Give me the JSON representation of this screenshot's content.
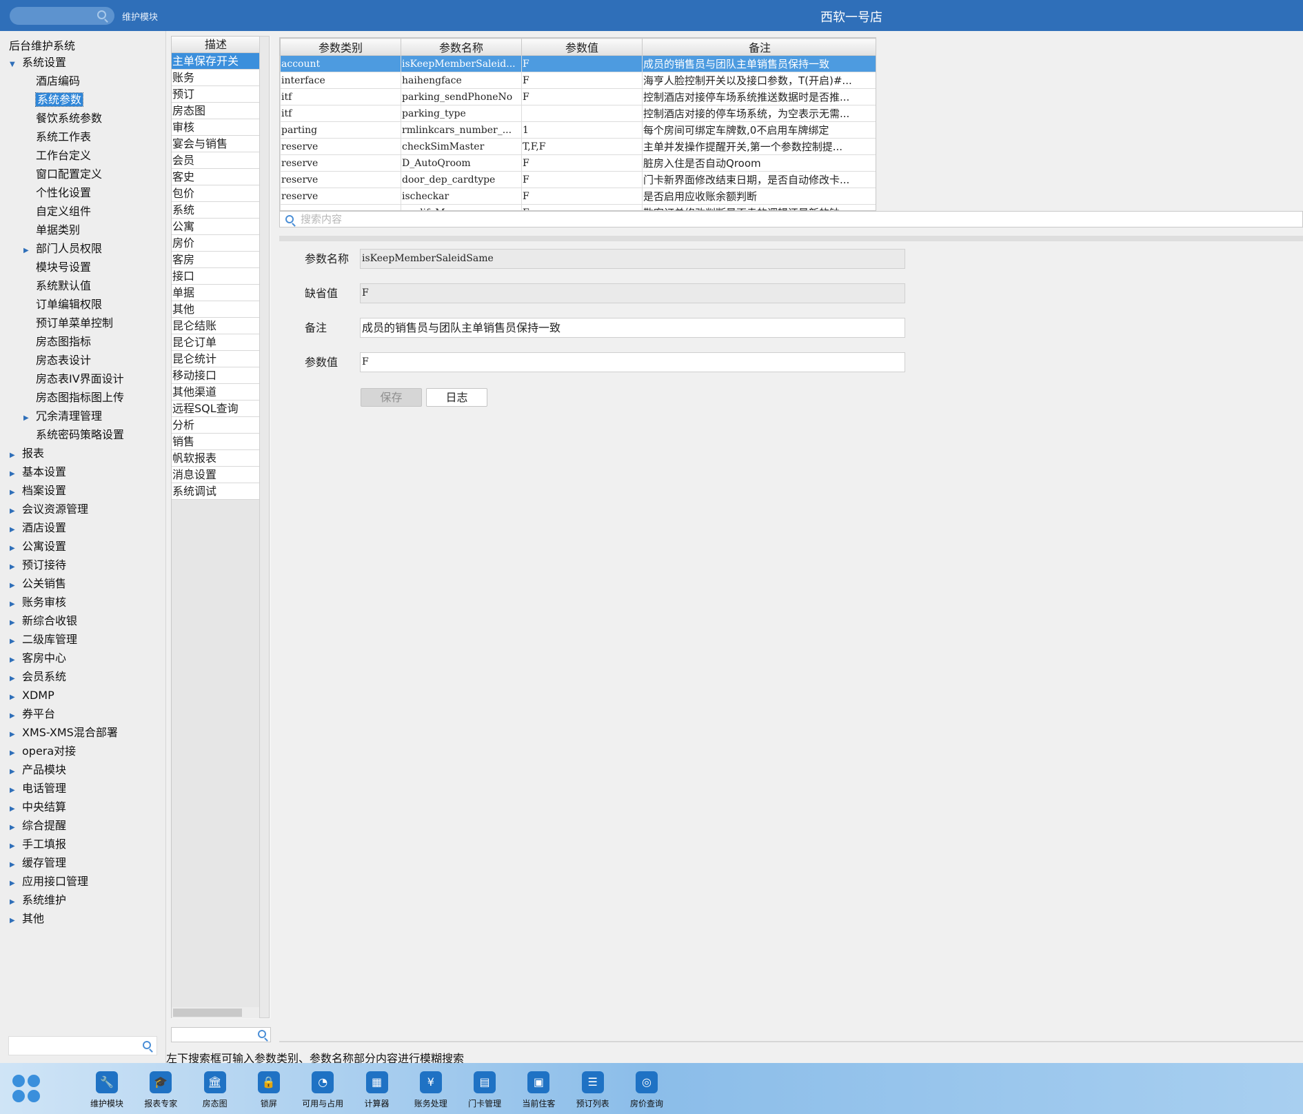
{
  "header": {
    "search_placeholder": "",
    "module": "维护模块",
    "title": "西软一号店"
  },
  "sidebar": {
    "root": "后台维护系统",
    "items": [
      {
        "label": "系统设置",
        "level": 1,
        "arrow": "▼",
        "selected": false
      },
      {
        "label": "酒店编码",
        "level": 2,
        "arrow": "",
        "selected": false
      },
      {
        "label": "系统参数",
        "level": 2,
        "arrow": "",
        "selected": true
      },
      {
        "label": "餐饮系统参数",
        "level": 2,
        "arrow": "",
        "selected": false
      },
      {
        "label": "系统工作表",
        "level": 2,
        "arrow": "",
        "selected": false
      },
      {
        "label": "工作台定义",
        "level": 2,
        "arrow": "",
        "selected": false
      },
      {
        "label": "窗口配置定义",
        "level": 2,
        "arrow": "",
        "selected": false
      },
      {
        "label": "个性化设置",
        "level": 2,
        "arrow": "",
        "selected": false
      },
      {
        "label": "自定义组件",
        "level": 2,
        "arrow": "",
        "selected": false
      },
      {
        "label": "单据类别",
        "level": 2,
        "arrow": "",
        "selected": false
      },
      {
        "label": "部门人员权限",
        "level": 2,
        "arrow": "▶",
        "selected": false
      },
      {
        "label": "模块号设置",
        "level": 2,
        "arrow": "",
        "selected": false
      },
      {
        "label": "系统默认值",
        "level": 2,
        "arrow": "",
        "selected": false
      },
      {
        "label": "订单编辑权限",
        "level": 2,
        "arrow": "",
        "selected": false
      },
      {
        "label": "预订单菜单控制",
        "level": 2,
        "arrow": "",
        "selected": false
      },
      {
        "label": "房态图指标",
        "level": 2,
        "arrow": "",
        "selected": false
      },
      {
        "label": "房态表设计",
        "level": 2,
        "arrow": "",
        "selected": false
      },
      {
        "label": "房态表IV界面设计",
        "level": 2,
        "arrow": "",
        "selected": false
      },
      {
        "label": "房态图指标图上传",
        "level": 2,
        "arrow": "",
        "selected": false
      },
      {
        "label": "冗余清理管理",
        "level": 2,
        "arrow": "▶",
        "selected": false
      },
      {
        "label": "系统密码策略设置",
        "level": 2,
        "arrow": "",
        "selected": false
      },
      {
        "label": "报表",
        "level": 1,
        "arrow": "▶",
        "selected": false
      },
      {
        "label": "基本设置",
        "level": 1,
        "arrow": "▶",
        "selected": false
      },
      {
        "label": "档案设置",
        "level": 1,
        "arrow": "▶",
        "selected": false
      },
      {
        "label": "会议资源管理",
        "level": 1,
        "arrow": "▶",
        "selected": false
      },
      {
        "label": "酒店设置",
        "level": 1,
        "arrow": "▶",
        "selected": false
      },
      {
        "label": "公寓设置",
        "level": 1,
        "arrow": "▶",
        "selected": false
      },
      {
        "label": "预订接待",
        "level": 1,
        "arrow": "▶",
        "selected": false
      },
      {
        "label": "公关销售",
        "level": 1,
        "arrow": "▶",
        "selected": false
      },
      {
        "label": "账务审核",
        "level": 1,
        "arrow": "▶",
        "selected": false
      },
      {
        "label": "新综合收银",
        "level": 1,
        "arrow": "▶",
        "selected": false
      },
      {
        "label": "二级库管理",
        "level": 1,
        "arrow": "▶",
        "selected": false
      },
      {
        "label": "客房中心",
        "level": 1,
        "arrow": "▶",
        "selected": false
      },
      {
        "label": "会员系统",
        "level": 1,
        "arrow": "▶",
        "selected": false
      },
      {
        "label": "XDMP",
        "level": 1,
        "arrow": "▶",
        "selected": false
      },
      {
        "label": "券平台",
        "level": 1,
        "arrow": "▶",
        "selected": false
      },
      {
        "label": "XMS-XMS混合部署",
        "level": 1,
        "arrow": "▶",
        "selected": false
      },
      {
        "label": "opera对接",
        "level": 1,
        "arrow": "▶",
        "selected": false
      },
      {
        "label": "产品模块",
        "level": 1,
        "arrow": "▶",
        "selected": false
      },
      {
        "label": "电话管理",
        "level": 1,
        "arrow": "▶",
        "selected": false
      },
      {
        "label": "中央结算",
        "level": 1,
        "arrow": "▶",
        "selected": false
      },
      {
        "label": "综合提醒",
        "level": 1,
        "arrow": "▶",
        "selected": false
      },
      {
        "label": "手工填报",
        "level": 1,
        "arrow": "▶",
        "selected": false
      },
      {
        "label": "缓存管理",
        "level": 1,
        "arrow": "▶",
        "selected": false
      },
      {
        "label": "应用接口管理",
        "level": 1,
        "arrow": "▶",
        "selected": false
      },
      {
        "label": "系统维护",
        "level": 1,
        "arrow": "▶",
        "selected": false
      },
      {
        "label": "其他",
        "level": 1,
        "arrow": "▶",
        "selected": false
      }
    ]
  },
  "categories": {
    "header": "描述",
    "items": [
      "主单保存开关",
      "账务",
      "预订",
      "房态图",
      "审核",
      "宴会与销售",
      "会员",
      "客史",
      "包价",
      "系统",
      "公寓",
      "房价",
      "客房",
      "接口",
      "单据",
      "其他",
      "昆仑结账",
      "昆仑订单",
      "昆仑统计",
      "移动接口",
      "其他渠道",
      "远程SQL查询",
      "分析",
      "销售",
      "帆软报表",
      "消息设置",
      "系统调试"
    ],
    "selected_index": 0
  },
  "params_table": {
    "columns": [
      "参数类别",
      "参数名称",
      "参数值",
      "备注"
    ],
    "rows": [
      [
        "account",
        "isKeepMemberSaleid...",
        "F",
        "成员的销售员与团队主单销售员保持一致"
      ],
      [
        "interface",
        "haihengface",
        "F",
        "海亨人脸控制开关以及接口参数，T(开启)#..."
      ],
      [
        "itf",
        "parking_sendPhoneNo",
        "F",
        "控制酒店对接停车场系统推送数据时是否推..."
      ],
      [
        "itf",
        "parking_type",
        "",
        "控制酒店对接的停车场系统，为空表示无需..."
      ],
      [
        "parting",
        "rmlinkcars_number_...",
        "1",
        "每个房间可绑定车牌数,0不启用车牌绑定"
      ],
      [
        "reserve",
        "checkSimMaster",
        "T,F,F",
        "主单并发操作提醒开关,第一个参数控制提..."
      ],
      [
        "reserve",
        "D_AutoQroom",
        "F",
        "脏房入住是否自动Qroom"
      ],
      [
        "reserve",
        "door_dep_cardtype",
        "F",
        "门卡新界面修改结束日期，是否自动修改卡..."
      ],
      [
        "reserve",
        "ischeckar",
        "F",
        "是否启用应收账余额判断"
      ],
      [
        "reserve",
        "modifyM...",
        "F",
        "散客订单修改判断是否走的逻辑还是新的钟..."
      ]
    ],
    "selected_index": 0,
    "search_placeholder": "搜索内容"
  },
  "form": {
    "name_label": "参数名称",
    "name_value": "isKeepMemberSaleidSame",
    "default_label": "缺省值",
    "default_value": "F",
    "remark_label": "备注",
    "remark_value": "成员的销售员与团队主单销售员保持一致",
    "value_label": "参数值",
    "value_value": "F",
    "save_label": "保存",
    "log_label": "日志"
  },
  "status_text": "左下搜索框可输入参数类别、参数名称部分内容进行模糊搜索",
  "taskbar": {
    "items": [
      {
        "label": "维护模块",
        "icon": "wrench-icon",
        "glyph": "🔧"
      },
      {
        "label": "报表专家",
        "icon": "graduation-cap-icon",
        "glyph": "🎓"
      },
      {
        "label": "房态图",
        "icon": "building-icon",
        "glyph": "🏛"
      },
      {
        "label": "锁屏",
        "icon": "lock-icon",
        "glyph": "🔒"
      },
      {
        "label": "可用与占用",
        "icon": "pie-chart-icon",
        "glyph": "◔"
      },
      {
        "label": "计算器",
        "icon": "calculator-icon",
        "glyph": "▦"
      },
      {
        "label": "账务处理",
        "icon": "money-bag-icon",
        "glyph": "¥"
      },
      {
        "label": "门卡管理",
        "icon": "card-icon",
        "glyph": "▤"
      },
      {
        "label": "当前住客",
        "icon": "id-card-icon",
        "glyph": "▣"
      },
      {
        "label": "预订列表",
        "icon": "document-list-icon",
        "glyph": "☰"
      },
      {
        "label": "房价查询",
        "icon": "coins-icon",
        "glyph": "◎"
      }
    ]
  }
}
